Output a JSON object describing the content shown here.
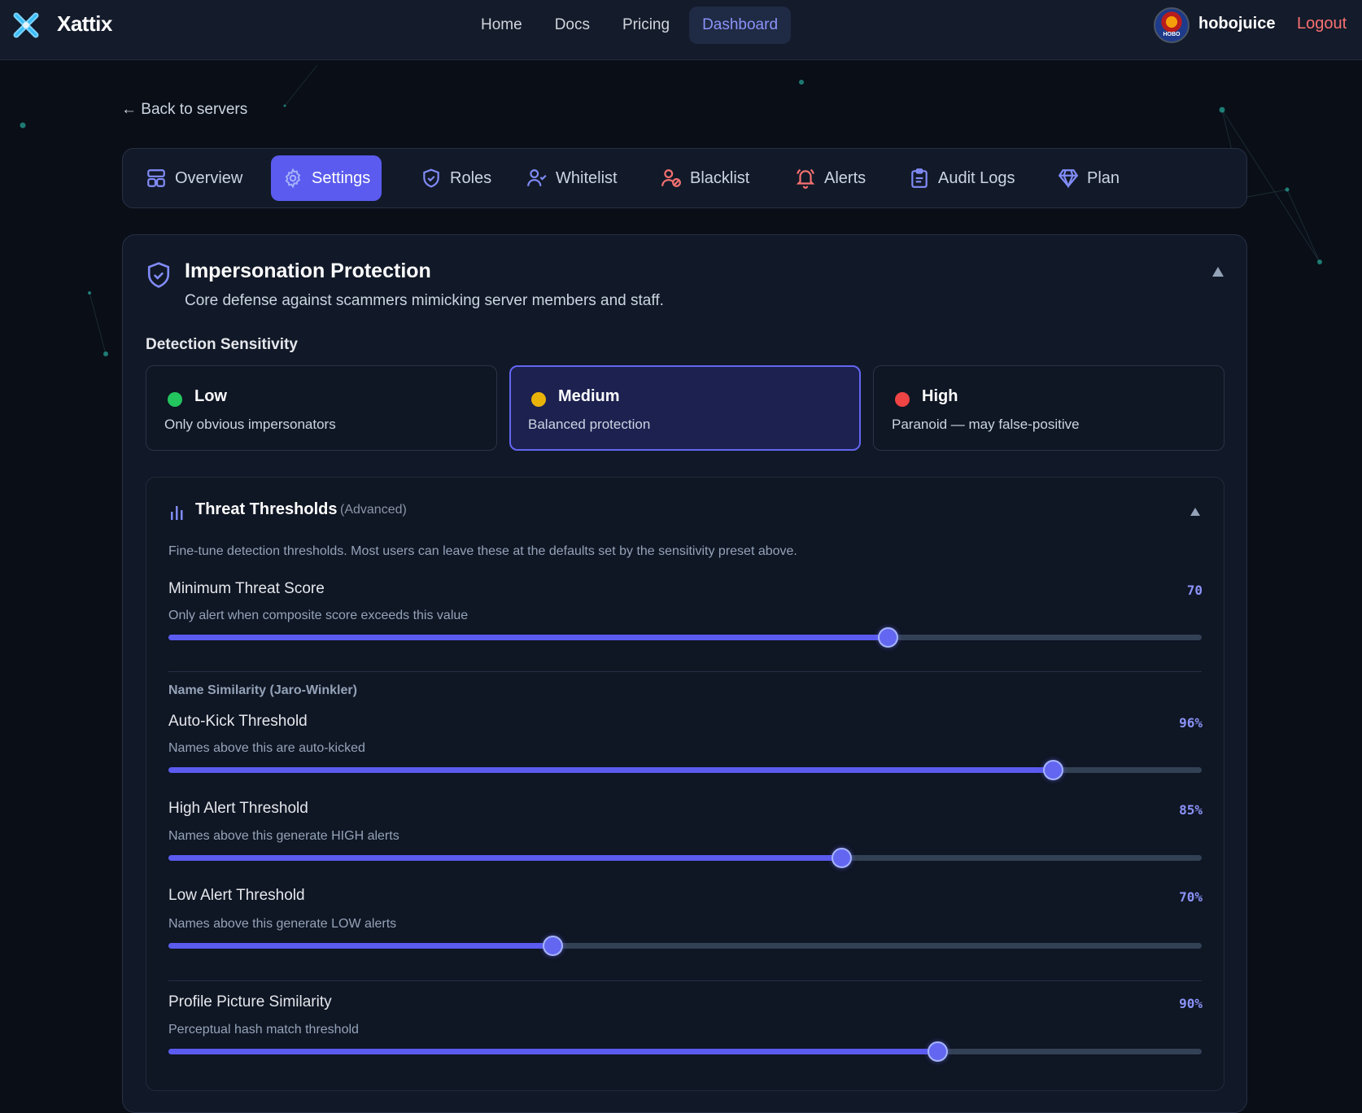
{
  "navbar": {
    "brand": "Xattix",
    "links": [
      {
        "label": "Home"
      },
      {
        "label": "Docs"
      },
      {
        "label": "Pricing"
      },
      {
        "label": "Dashboard",
        "active": true
      }
    ],
    "username": "hobojuice",
    "avatar_text": "HOBO",
    "logout": "Logout"
  },
  "back_link": "← Back to servers",
  "tabs": [
    {
      "label": "Overview",
      "icon": "layout-icon"
    },
    {
      "label": "Settings",
      "icon": "gear-icon",
      "active": true
    },
    {
      "label": "Roles",
      "icon": "shield-icon"
    },
    {
      "label": "Whitelist",
      "icon": "user-check-icon"
    },
    {
      "label": "Blacklist",
      "icon": "user-block-icon"
    },
    {
      "label": "Alerts",
      "icon": "bell-icon"
    },
    {
      "label": "Audit Logs",
      "icon": "clipboard-icon"
    },
    {
      "label": "Plan",
      "icon": "diamond-icon"
    }
  ],
  "section": {
    "title": "Impersonation Protection",
    "subtitle": "Core defense against scammers mimicking server members and staff.",
    "sensitivity_label": "Detection Sensitivity",
    "sensitivity_options": [
      {
        "name": "Low",
        "desc": "Only obvious impersonators",
        "color": "#22c55e"
      },
      {
        "name": "Medium",
        "desc": "Balanced protection",
        "color": "#eab308",
        "selected": true
      },
      {
        "name": "High",
        "desc": "Paranoid — may false-positive",
        "color": "#ef4444"
      }
    ]
  },
  "thresholds": {
    "title": "Threat Thresholds",
    "advanced": "(Advanced)",
    "description": "Fine-tune detection thresholds. Most users can leave these at the defaults set by the sensitivity preset above.",
    "min_score": {
      "label": "Minimum Threat Score",
      "help": "Only alert when composite score exceeds this value",
      "value_text": "70",
      "value": 70
    },
    "name_group": "Name Similarity (Jaro-Winkler)",
    "auto_kick": {
      "label": "Auto-Kick Threshold",
      "help": "Names above this are auto-kicked",
      "value_text": "96%",
      "value": 96
    },
    "high_alert": {
      "label": "High Alert Threshold",
      "help": "Names above this generate HIGH alerts",
      "value_text": "85%",
      "value": 85
    },
    "low_alert": {
      "label": "Low Alert Threshold",
      "help": "Names above this generate LOW alerts",
      "value_text": "70%",
      "value": 70
    },
    "pfp": {
      "label": "Profile Picture Similarity",
      "help": "Perceptual hash match threshold",
      "value_text": "90%",
      "value": 90
    }
  },
  "colors": {
    "accent": "#5b5bf0",
    "logout": "#f87171",
    "background": "#0a0e17"
  }
}
